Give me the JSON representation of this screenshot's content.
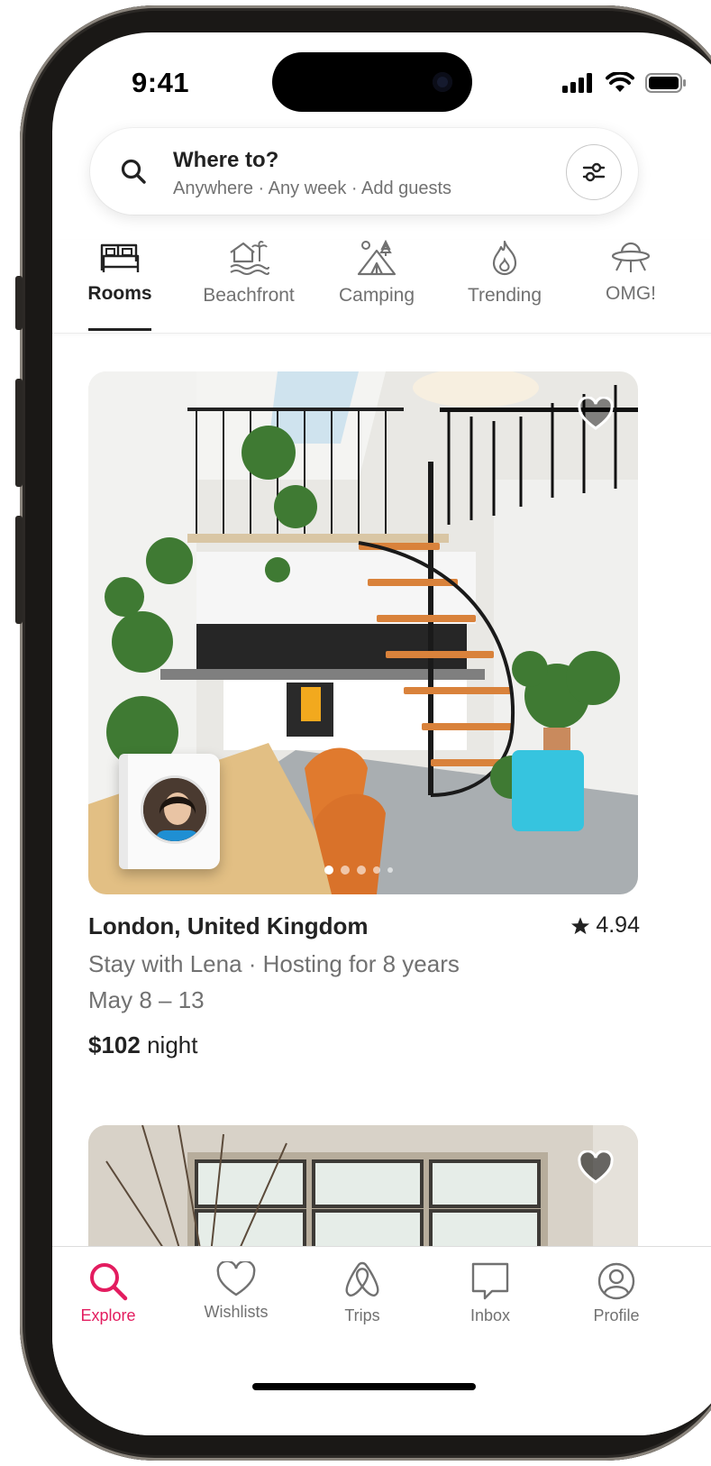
{
  "status": {
    "time": "9:41"
  },
  "search": {
    "title": "Where to?",
    "subtitle": "Anywhere · Any week · Add guests"
  },
  "categories": [
    {
      "label": "Rooms",
      "icon": "bed-icon",
      "active": true
    },
    {
      "label": "Beachfront",
      "icon": "beach-house-icon"
    },
    {
      "label": "Camping",
      "icon": "tent-icon"
    },
    {
      "label": "Trending",
      "icon": "flame-icon"
    },
    {
      "label": "OMG!",
      "icon": "ufo-icon"
    }
  ],
  "listing": {
    "title": "London, United Kingdom",
    "rating": "4.94",
    "subtitle": "Stay with Lena · Hosting for 8 years",
    "dates": "May 8 – 13",
    "price": "$102",
    "price_unit": "night",
    "photo_count": 5,
    "photo_index": 0
  },
  "tabs": [
    {
      "label": "Explore",
      "icon": "search-icon",
      "active": true
    },
    {
      "label": "Wishlists",
      "icon": "heart-icon"
    },
    {
      "label": "Trips",
      "icon": "airbnb-logo-icon"
    },
    {
      "label": "Inbox",
      "icon": "message-icon"
    },
    {
      "label": "Profile",
      "icon": "profile-icon"
    }
  ],
  "colors": {
    "accent": "#e31c5f",
    "text": "#222222",
    "muted": "#717171"
  }
}
